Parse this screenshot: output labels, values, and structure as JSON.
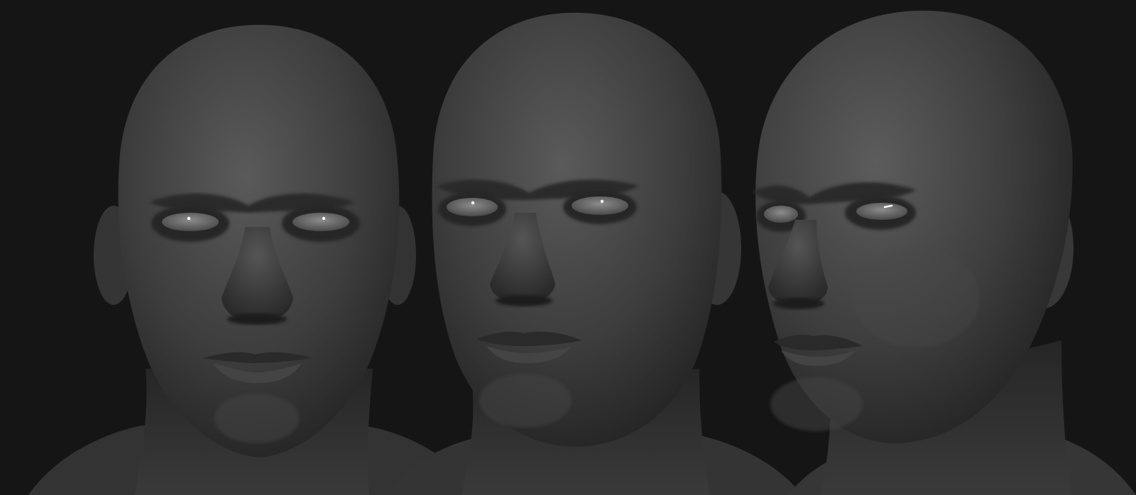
{
  "colors": {
    "background": "#151515",
    "skin_light": "#5c5c5c",
    "skin_mid": "#3c3c3c",
    "skin_dark": "#232323",
    "eye_white": "#8a8a8a",
    "highlight": "#ffffff"
  },
  "busts": [
    {
      "view": "front"
    },
    {
      "view": "three-quarter-left"
    },
    {
      "view": "three-quarter-right"
    }
  ]
}
